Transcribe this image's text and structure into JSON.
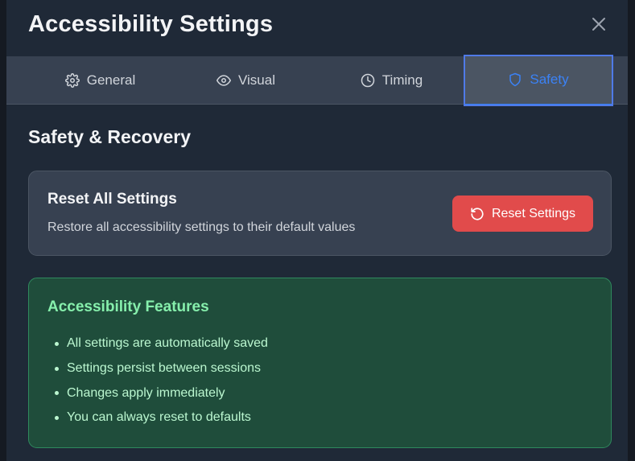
{
  "dialog": {
    "title": "Accessibility Settings"
  },
  "tabs": [
    {
      "label": "General",
      "icon": "gear-icon"
    },
    {
      "label": "Visual",
      "icon": "eye-icon"
    },
    {
      "label": "Timing",
      "icon": "clock-icon"
    },
    {
      "label": "Safety",
      "icon": "shield-icon",
      "active": true
    }
  ],
  "section": {
    "title": "Safety & Recovery"
  },
  "reset_card": {
    "title": "Reset All Settings",
    "description": "Restore all accessibility settings to their default values",
    "button_label": "Reset Settings",
    "button_icon": "rotate-ccw-icon"
  },
  "features_card": {
    "title": "Accessibility Features",
    "items": [
      "All settings are automatically saved",
      "Settings persist between sessions",
      "Changes apply immediately",
      "You can always reset to defaults"
    ]
  },
  "colors": {
    "background": "#1f2937",
    "accent": "#3b82f6",
    "danger": "#e14b4b",
    "success_bg": "#1f4d3b",
    "success_text": "#86efac"
  }
}
